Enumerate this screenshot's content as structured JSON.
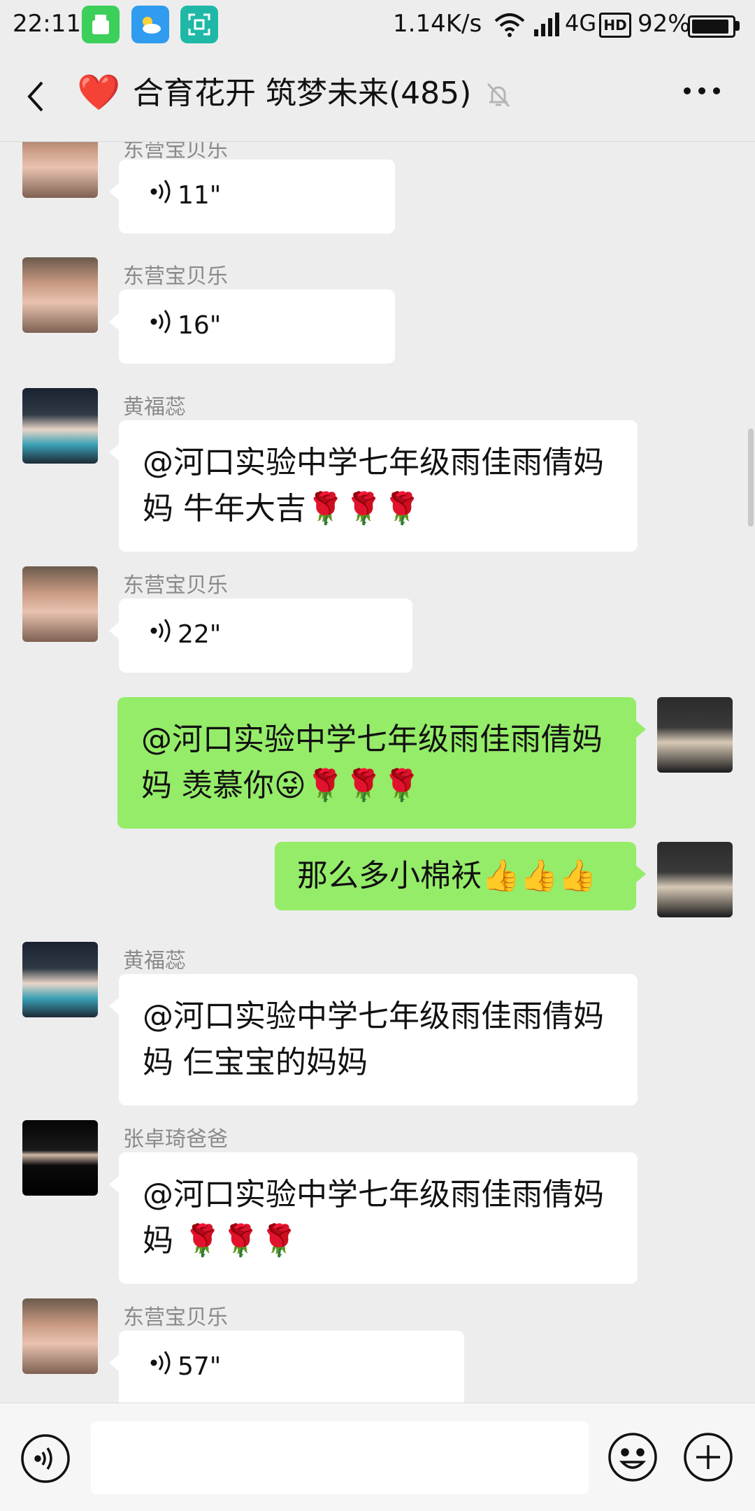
{
  "status_bar": {
    "time": "22:11",
    "net_speed": "1.14K/s",
    "network": "4G",
    "hd": "HD",
    "battery": "92%",
    "battery_level": 0.92
  },
  "header": {
    "title": "合育花开 筑梦未来(485)",
    "heart_icon": "❤️"
  },
  "messages": [
    {
      "sender": "东营宝贝乐",
      "type": "voice",
      "duration": "11\"",
      "side": "left"
    },
    {
      "sender": "东营宝贝乐",
      "type": "voice",
      "duration": "16\"",
      "side": "left"
    },
    {
      "sender": "黄福蕊",
      "type": "text",
      "line1": "@河口实验中学七年级雨佳雨倩妈",
      "line2": "妈  牛年大吉🌹🌹🌹",
      "side": "left"
    },
    {
      "sender": "东营宝贝乐",
      "type": "voice",
      "duration": "22\"",
      "side": "left"
    },
    {
      "type": "text",
      "line1": "@河口实验中学七年级雨佳雨倩妈",
      "line2": "妈  羡慕你😜🌹🌹🌹",
      "side": "right"
    },
    {
      "type": "text",
      "line1": "那么多小棉袄👍👍👍",
      "side": "right"
    },
    {
      "sender": "黄福蕊",
      "type": "text",
      "line1": "@河口实验中学七年级雨佳雨倩妈",
      "line2": "妈  仨宝宝的妈妈",
      "side": "left"
    },
    {
      "sender": "张卓琦爸爸",
      "type": "text",
      "line1": "@河口实验中学七年级雨佳雨倩妈",
      "line2": "妈  🌹🌹🌹",
      "side": "left"
    },
    {
      "sender": "东营宝贝乐",
      "type": "voice",
      "duration": "57\"",
      "side": "left"
    }
  ],
  "input_bar": {
    "voice_icon": "voice-input-icon",
    "emoji_icon": "emoji-icon",
    "plus_icon": "plus-icon"
  }
}
